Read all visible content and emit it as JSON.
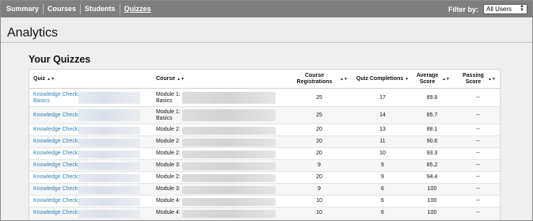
{
  "nav": {
    "tabs": [
      {
        "label": "Summary",
        "active": false
      },
      {
        "label": "Courses",
        "active": false
      },
      {
        "label": "Students",
        "active": false
      },
      {
        "label": "Quizzes",
        "active": true
      }
    ],
    "filter_label": "Filter by:",
    "filter_value": "All Users"
  },
  "page": {
    "title": "Analytics",
    "section_title": "Your Quizzes"
  },
  "table": {
    "headers": {
      "quiz": "Quiz",
      "course": "Course",
      "registrations": "Course Registrations",
      "completions": "Quiz Completions",
      "average": "Average Score",
      "passing": "Passing Score"
    },
    "rows": [
      {
        "quiz": "Knowledge Check:",
        "quiz2": "Basics",
        "course": "Module 1:",
        "course2": "Basics",
        "registrations": "25",
        "completions": "17",
        "average": "89.8",
        "passing": "--"
      },
      {
        "quiz": "Knowledge Check:",
        "quiz2": "",
        "course": "Module 1:",
        "course2": "Basics",
        "registrations": "25",
        "completions": "14",
        "average": "85.7",
        "passing": "--"
      },
      {
        "quiz": "Knowledge Check:",
        "quiz2": "",
        "course": "Module 2:",
        "course2": "",
        "registrations": "20",
        "completions": "13",
        "average": "88.1",
        "passing": "--"
      },
      {
        "quiz": "Knowledge Check:",
        "quiz2": "",
        "course": "Module 2:",
        "course2": "",
        "registrations": "20",
        "completions": "11",
        "average": "90.6",
        "passing": "--"
      },
      {
        "quiz": "Knowledge Check:",
        "quiz2": "",
        "course": "Module 2:",
        "course2": "",
        "registrations": "20",
        "completions": "10",
        "average": "93.3",
        "passing": "--"
      },
      {
        "quiz": "Knowledge Check:",
        "quiz2": "",
        "course": "Module 3:",
        "course2": "",
        "registrations": "9",
        "completions": "9",
        "average": "85.2",
        "passing": "--"
      },
      {
        "quiz": "Knowledge Check:",
        "quiz2": "",
        "course": "Module 2:",
        "course2": "",
        "registrations": "20",
        "completions": "9",
        "average": "94.4",
        "passing": "--"
      },
      {
        "quiz": "Knowledge Check:",
        "quiz2": "",
        "course": "Module 3:",
        "course2": "",
        "registrations": "9",
        "completions": "6",
        "average": "100",
        "passing": "--"
      },
      {
        "quiz": "Knowledge Check:",
        "quiz2": "",
        "course": "Module 4:",
        "course2": "",
        "registrations": "10",
        "completions": "6",
        "average": "100",
        "passing": "--"
      },
      {
        "quiz": "Knowledge Check:",
        "quiz2": "",
        "course": "Module 4:",
        "course2": "",
        "registrations": "10",
        "completions": "6",
        "average": "100",
        "passing": "--"
      }
    ]
  },
  "colors": {
    "nav_bg": "#7f7f7f",
    "link": "#2f7fc1"
  }
}
